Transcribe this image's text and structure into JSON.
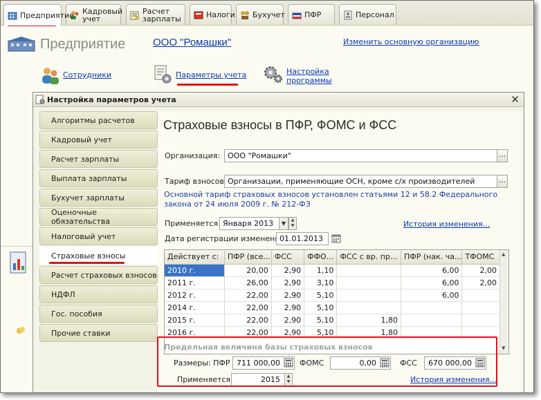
{
  "tabs": [
    {
      "label": "Предприятие",
      "icon": "enterprise-icon",
      "active": true
    },
    {
      "label": "Кадровый\nучет",
      "icon": "hr-icon",
      "active": false
    },
    {
      "label": "Расчет\nзарплаты",
      "icon": "payroll-icon",
      "active": false
    },
    {
      "label": "Налоги",
      "icon": "taxes-icon",
      "active": false
    },
    {
      "label": "Бухучет",
      "icon": "accounting-icon",
      "active": false
    },
    {
      "label": "ПФР",
      "icon": "pfr-icon",
      "active": false
    },
    {
      "label": "Персонал",
      "icon": "personnel-icon",
      "active": false
    }
  ],
  "header": {
    "title": "Предприятие",
    "org_link": "ООО \"Ромашки\"",
    "change_org": "Изменить основную организацию"
  },
  "quick": {
    "employees": "Сотрудники",
    "params": "Параметры учета",
    "settings": "Настройка\nпрограммы"
  },
  "dialog": {
    "title": "Настройка параметров учета",
    "nav": [
      "Алгоритмы расчетов",
      "Кадровый учет",
      "Расчет зарплаты",
      "Выплата зарплаты",
      "Бухучет зарплаты",
      "Оценочные обязательства",
      "Налоговый учет",
      "Страховые взносы",
      "Расчет страховых взносов",
      "НДФЛ",
      "Гос. пособия",
      "Прочие ставки"
    ],
    "active_nav": 7,
    "content": {
      "title": "Страховые взносы в ПФР, ФОМС и ФСС",
      "org_label": "Организация:",
      "org_value": "ООО \"Ромашки\"",
      "tariff_label": "Тариф взносов:",
      "tariff_value": "Организации, применяющие ОСН, кроме с/х производителей",
      "info": "Основной тариф страховых взносов установлен статьями 12 и 58.2 Федерального закона от 24 июля 2009 г. № 212-ФЗ",
      "applies_label": "Применяется с:",
      "applies_value": "Января  2013",
      "history_link": "История изменения...",
      "regdate_label": "Дата регистрации изменений:",
      "regdate_value": "01.01.2013",
      "table": {
        "columns": [
          "Действует с:",
          "ПФР (все...",
          "ФСС",
          "ФФО...",
          "ФСС с вр. пр...",
          "ПФР (нак. ча...",
          "ТФОМС"
        ],
        "rows": [
          [
            "2010 г.",
            "20,00",
            "2,90",
            "1,10",
            "",
            "6,00",
            "2,00"
          ],
          [
            "2011 г.",
            "26,00",
            "2,90",
            "3,10",
            "",
            "6,00",
            "2,00"
          ],
          [
            "2012 г.",
            "22,00",
            "2,90",
            "5,10",
            "",
            "6,00",
            ""
          ],
          [
            "2014 г.",
            "22,00",
            "2,90",
            "5,10",
            "",
            "",
            ""
          ],
          [
            "2015 г.",
            "22,00",
            "2,90",
            "5,10",
            "1,80",
            "",
            ""
          ],
          [
            "2016 г.",
            "22,00",
            "2,90",
            "5,10",
            "1,80",
            "",
            ""
          ]
        ],
        "selected_row": 0
      },
      "group_title": "Предельная величина базы страховых взносов",
      "sizes_label": "Размеры: ПФР",
      "pfr_value": "711 000,00",
      "foms_label": "ФОМС",
      "foms_value": "0,00",
      "fss_label": "ФСС",
      "fss_value": "670 000,00",
      "applies2_label": "Применяется с:",
      "applies2_value": "2015",
      "history2_link": "История изменения..."
    }
  },
  "colors": {
    "accent_red": "#e0101a",
    "link_blue": "#0a37b7",
    "selection_blue": "#3a74c8"
  }
}
